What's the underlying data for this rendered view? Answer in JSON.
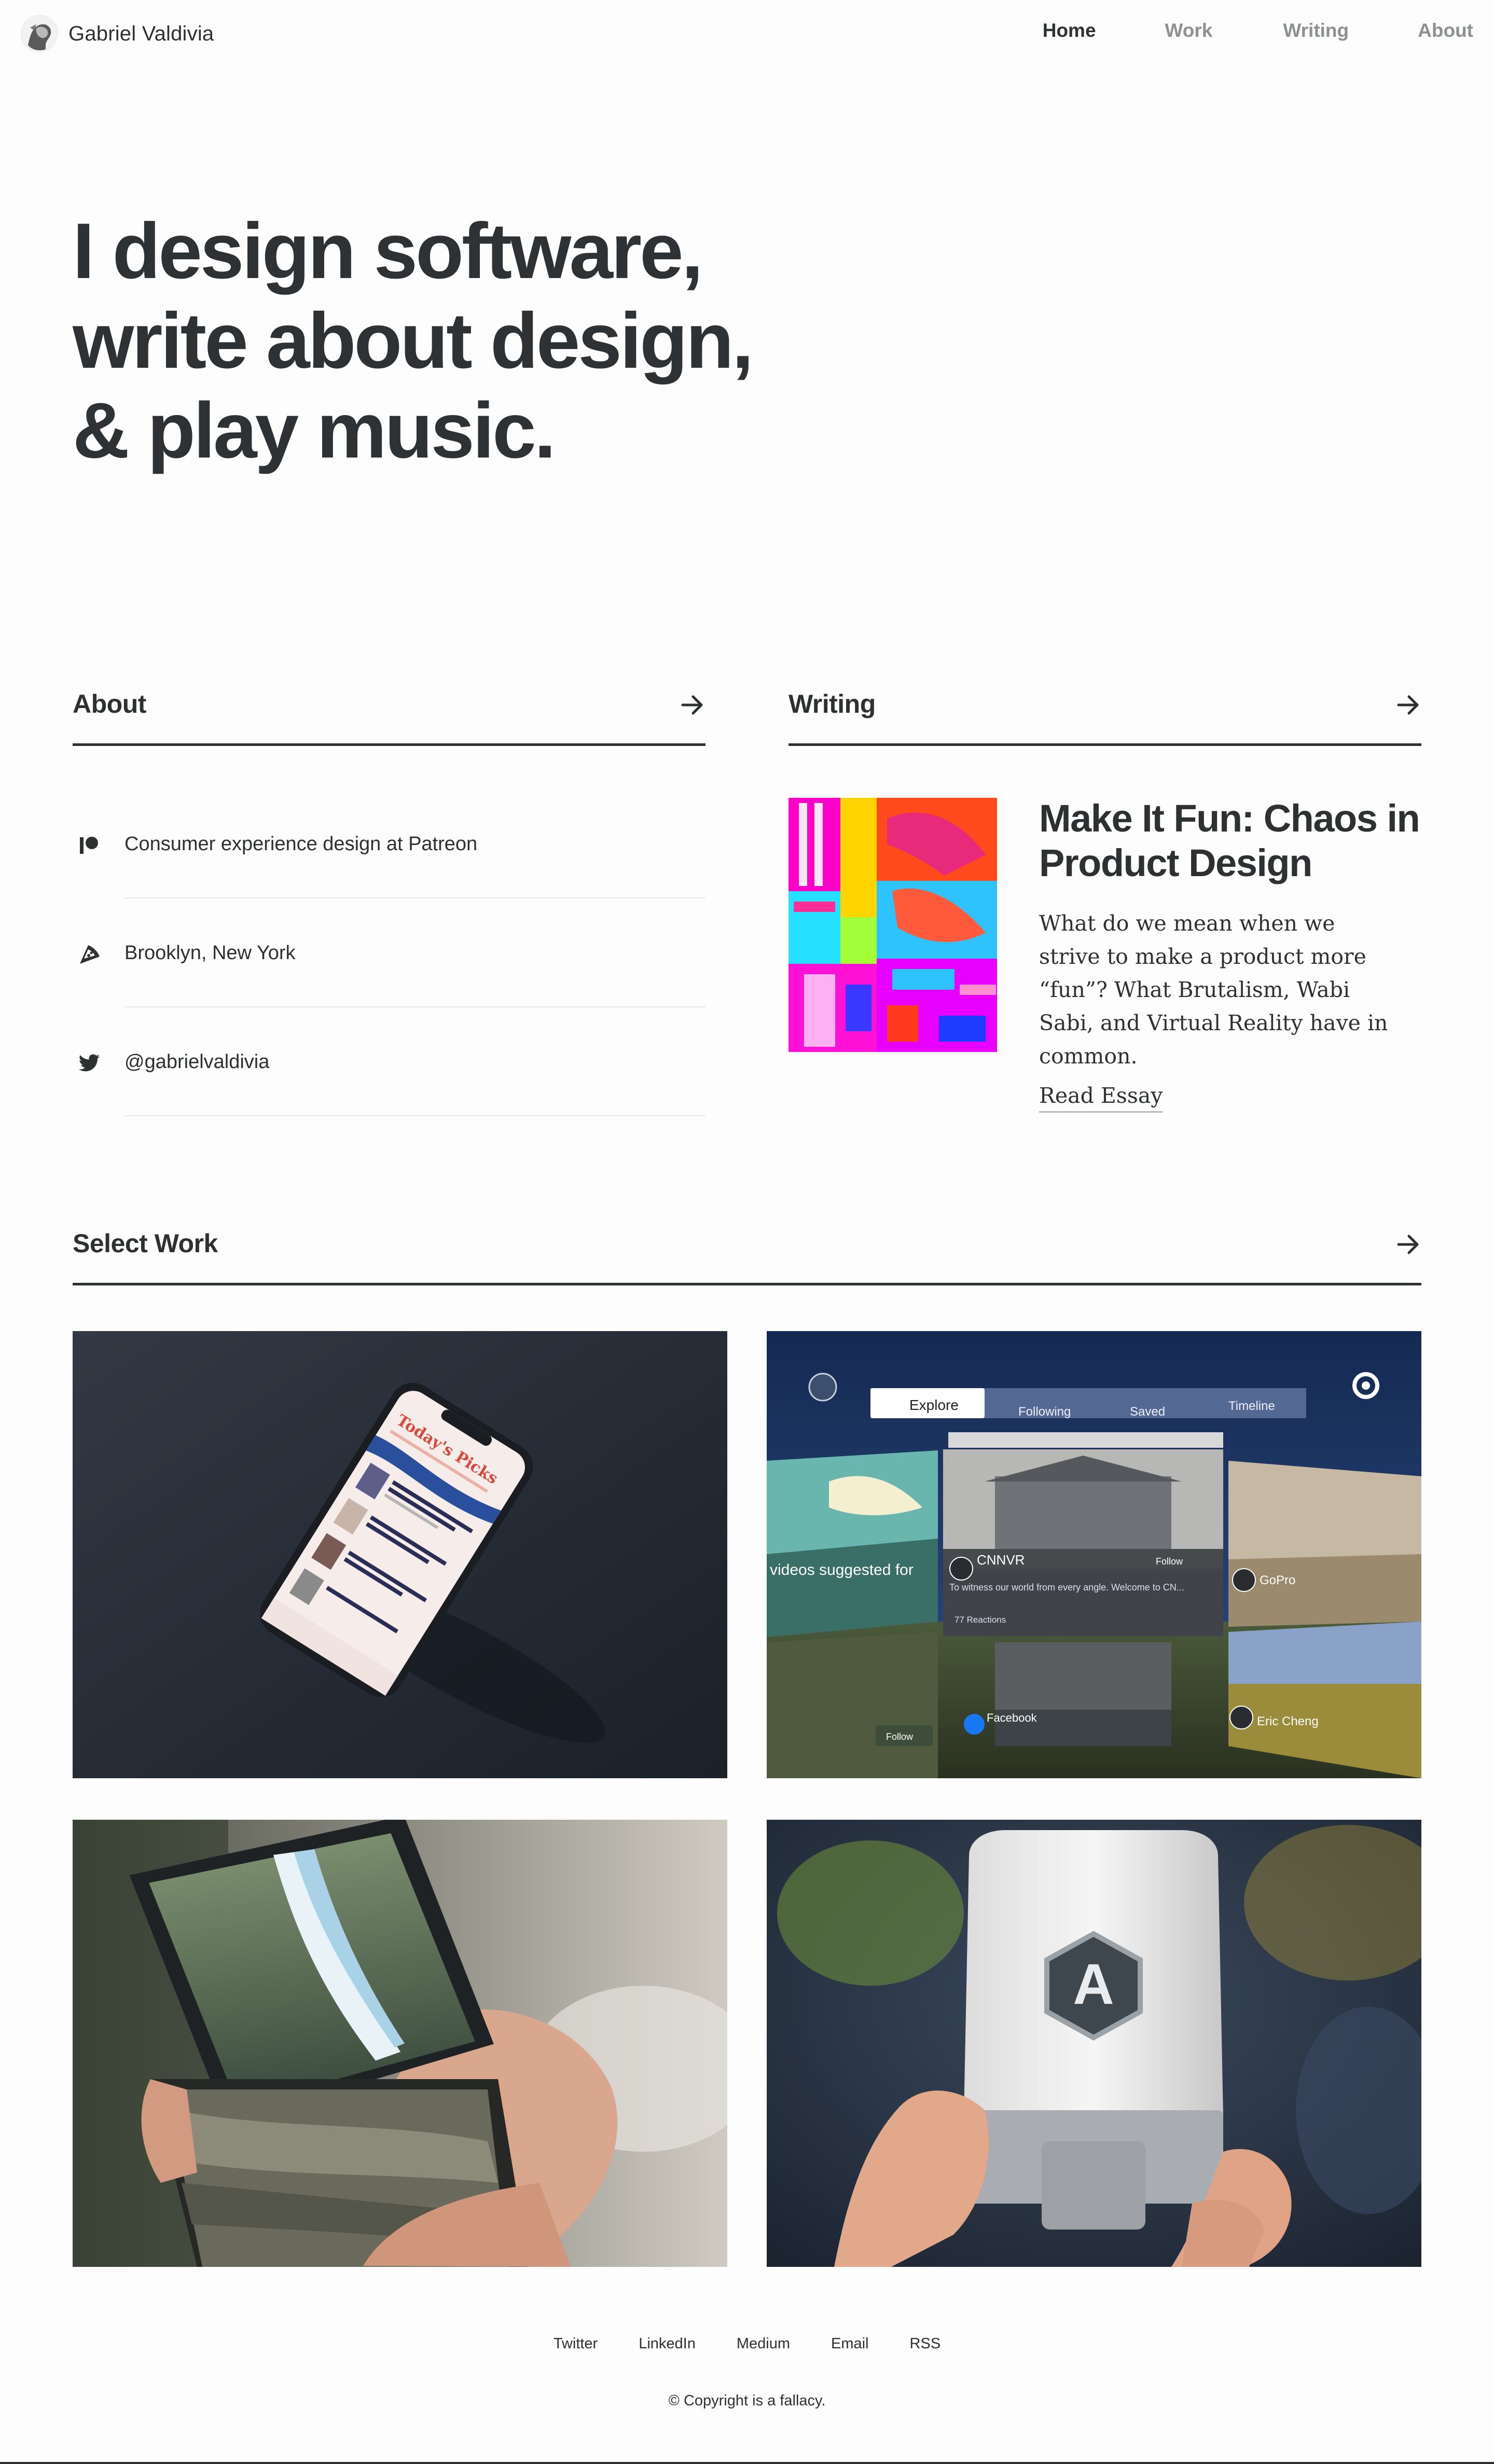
{
  "header": {
    "brand_name": "Gabriel Valdivia",
    "avatar_icon": "avatar-portrait-icon",
    "nav": [
      {
        "label": "Home",
        "active": true
      },
      {
        "label": "Work",
        "active": false
      },
      {
        "label": "Writing",
        "active": false
      },
      {
        "label": "About",
        "active": false
      }
    ]
  },
  "hero": {
    "lines": [
      "I design software,",
      "write about design,",
      "& play music."
    ]
  },
  "about": {
    "title": "About",
    "arrow_icon": "arrow-right-icon",
    "items": [
      {
        "icon": "patreon-icon",
        "text": "Consumer experience design at Patreon"
      },
      {
        "icon": "pizza-slice-icon",
        "text": "Brooklyn, New York"
      },
      {
        "icon": "twitter-bird-icon",
        "text": "@gabrielvaldivia"
      }
    ]
  },
  "writing": {
    "title": "Writing",
    "arrow_icon": "arrow-right-icon",
    "essay": {
      "title": "Make It Fun: Chaos in Product Design",
      "body": "What do we mean when we strive to make a product more “fun”? What Brutalism, Wabi Sabi, and Virtual Reality have in common.",
      "link_label": "Read Essay"
    }
  },
  "work": {
    "title": "Select Work",
    "arrow_icon": "arrow-right-icon",
    "tiles": [
      {
        "name": "work-tile-todays-picks",
        "screen_text": "Today's Picks"
      },
      {
        "name": "work-tile-vr-feed",
        "tabs": [
          "Explore",
          "Following",
          "Saved",
          "Timeline"
        ],
        "labels": [
          "videos suggested for",
          "CNNVR",
          "To witness our world from every angle. Welcome to CN...",
          "GoPro",
          "Facebook",
          "Eric Cheng",
          "Follow",
          "77 Reactions"
        ]
      },
      {
        "name": "work-tile-waterfall-phone"
      },
      {
        "name": "work-tile-automatic-adapter",
        "logo_letter": "A"
      }
    ]
  },
  "footer": {
    "links": [
      "Twitter",
      "LinkedIn",
      "Medium",
      "Email",
      "RSS"
    ],
    "copyright": "© Copyright is a fallacy."
  },
  "colors": {
    "text": "#2d3132",
    "muted_nav": "#8d9192",
    "background": "#fdfdfd",
    "rule_light": "#e8e8e8"
  }
}
